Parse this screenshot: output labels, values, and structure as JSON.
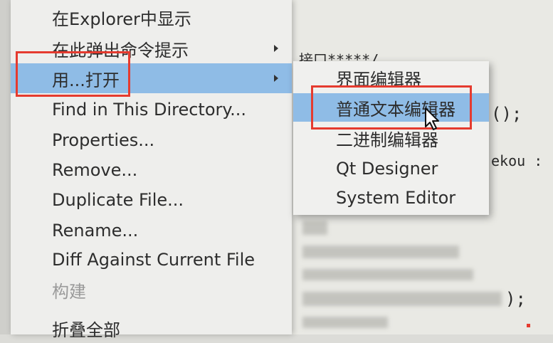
{
  "menu": {
    "items": [
      {
        "label": "在Explorer中显示",
        "submenu": false,
        "highlight": false,
        "disabled": false
      },
      {
        "label": "在此弹出命令提示",
        "submenu": true,
        "highlight": false,
        "disabled": false
      },
      {
        "label": "用...打开",
        "submenu": true,
        "highlight": true,
        "disabled": false
      },
      {
        "label": "Find in This Directory...",
        "submenu": false,
        "highlight": false,
        "disabled": false
      },
      {
        "label": "Properties...",
        "submenu": false,
        "highlight": false,
        "disabled": false
      },
      {
        "label": "Remove...",
        "submenu": false,
        "highlight": false,
        "disabled": false
      },
      {
        "label": "Duplicate File...",
        "submenu": false,
        "highlight": false,
        "disabled": false
      },
      {
        "label": "Rename...",
        "submenu": false,
        "highlight": false,
        "disabled": false
      },
      {
        "label": "Diff Against Current File",
        "submenu": false,
        "highlight": false,
        "disabled": false
      },
      {
        "label": "构建",
        "submenu": false,
        "highlight": false,
        "disabled": true
      },
      {
        "label": "折叠全部",
        "submenu": false,
        "highlight": false,
        "disabled": false
      }
    ]
  },
  "submenu": {
    "items": [
      {
        "label": "界面编辑器",
        "highlight": false
      },
      {
        "label": "普通文本编辑器",
        "highlight": true
      },
      {
        "label": "二进制编辑器",
        "highlight": false
      },
      {
        "label": "Qt Designer",
        "highlight": false
      },
      {
        "label": "System Editor",
        "highlight": false
      }
    ]
  },
  "editor": {
    "line1": "接口*****/",
    "line2": "();",
    "line3": "ekou :",
    "line4": ");"
  },
  "colors": {
    "highlight": "#8fbce6",
    "annotation": "#e53b2f",
    "menu_bg": "#eeeeec"
  }
}
